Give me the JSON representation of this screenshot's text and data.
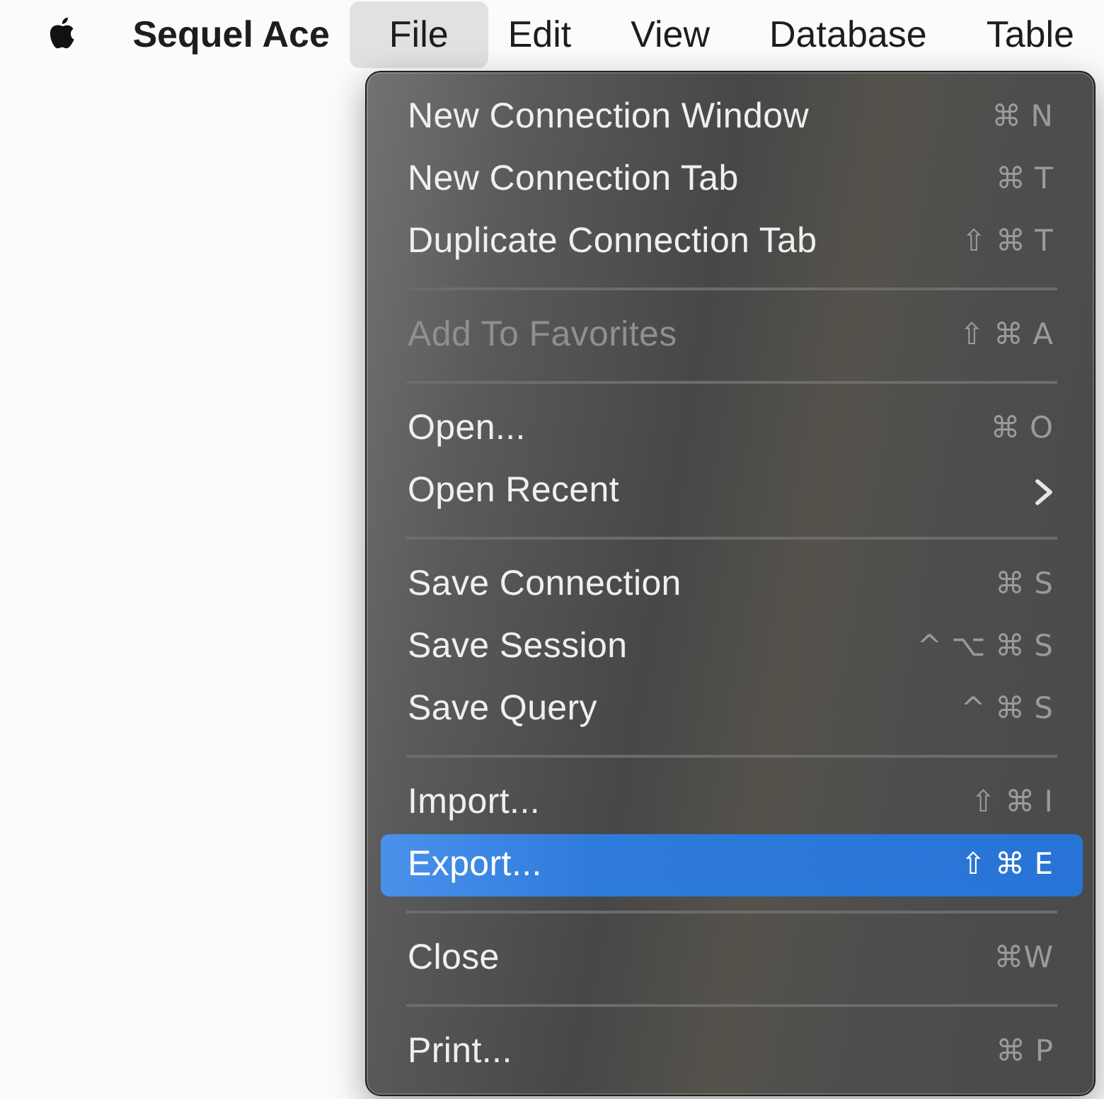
{
  "menu_bar": {
    "app_name": "Sequel Ace",
    "menus": [
      {
        "label": "File",
        "selected": true
      },
      {
        "label": "Edit",
        "selected": false
      },
      {
        "label": "View",
        "selected": false
      },
      {
        "label": "Database",
        "selected": false
      },
      {
        "label": "Table",
        "selected": false
      }
    ]
  },
  "open_menu": {
    "groups": [
      [
        {
          "label": "New Connection Window",
          "shortcut": "⌘ N",
          "disabled": false,
          "selected": false,
          "submenu": false
        },
        {
          "label": "New Connection Tab",
          "shortcut": "⌘ T",
          "disabled": false,
          "selected": false,
          "submenu": false
        },
        {
          "label": "Duplicate Connection Tab",
          "shortcut": "⇧ ⌘ T",
          "disabled": false,
          "selected": false,
          "submenu": false
        }
      ],
      [
        {
          "label": "Add To Favorites",
          "shortcut": "⇧ ⌘ A",
          "disabled": true,
          "selected": false,
          "submenu": false
        }
      ],
      [
        {
          "label": "Open...",
          "shortcut": "⌘ O",
          "disabled": false,
          "selected": false,
          "submenu": false
        },
        {
          "label": "Open Recent",
          "disabled": false,
          "selected": false,
          "submenu": true
        }
      ],
      [
        {
          "label": "Save Connection",
          "shortcut": "⌘ S",
          "disabled": false,
          "selected": false,
          "submenu": false
        },
        {
          "label": "Save Session",
          "shortcut": "^ ⌥ ⌘ S",
          "disabled": false,
          "selected": false,
          "submenu": false
        },
        {
          "label": "Save Query",
          "shortcut": "^ ⌘ S",
          "disabled": false,
          "selected": false,
          "submenu": false
        }
      ],
      [
        {
          "label": "Import...",
          "shortcut": "⇧ ⌘ I",
          "disabled": false,
          "selected": false,
          "submenu": false
        },
        {
          "label": "Export...",
          "shortcut": "⇧ ⌘ E",
          "disabled": false,
          "selected": true,
          "submenu": false
        }
      ],
      [
        {
          "label": "Close",
          "shortcut": "⌘W",
          "disabled": false,
          "selected": false,
          "submenu": false
        }
      ],
      [
        {
          "label": "Print...",
          "shortcut": "⌘ P",
          "disabled": false,
          "selected": false,
          "submenu": false
        }
      ]
    ]
  }
}
